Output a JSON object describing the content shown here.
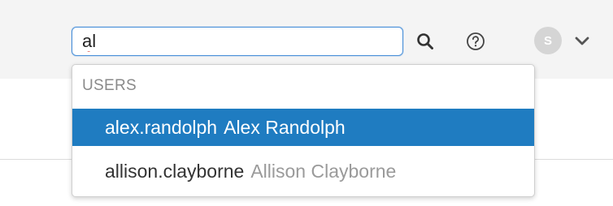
{
  "search": {
    "value": "al"
  },
  "header": {
    "avatar_initial": "S",
    "icons": {
      "search": "search-icon",
      "help": "help-circle-icon",
      "chevron": "chevron-down-icon"
    }
  },
  "dropdown": {
    "section_label": "USERS",
    "results": [
      {
        "username": "alex.randolph",
        "name": "Alex Randolph",
        "highlighted": true
      },
      {
        "username": "allison.clayborne",
        "name": "Allison Clayborne",
        "highlighted": false
      }
    ]
  },
  "colors": {
    "accent": "#1f7cc1",
    "focus_border": "#4a90d9",
    "header_bg": "#f4f4f4"
  }
}
